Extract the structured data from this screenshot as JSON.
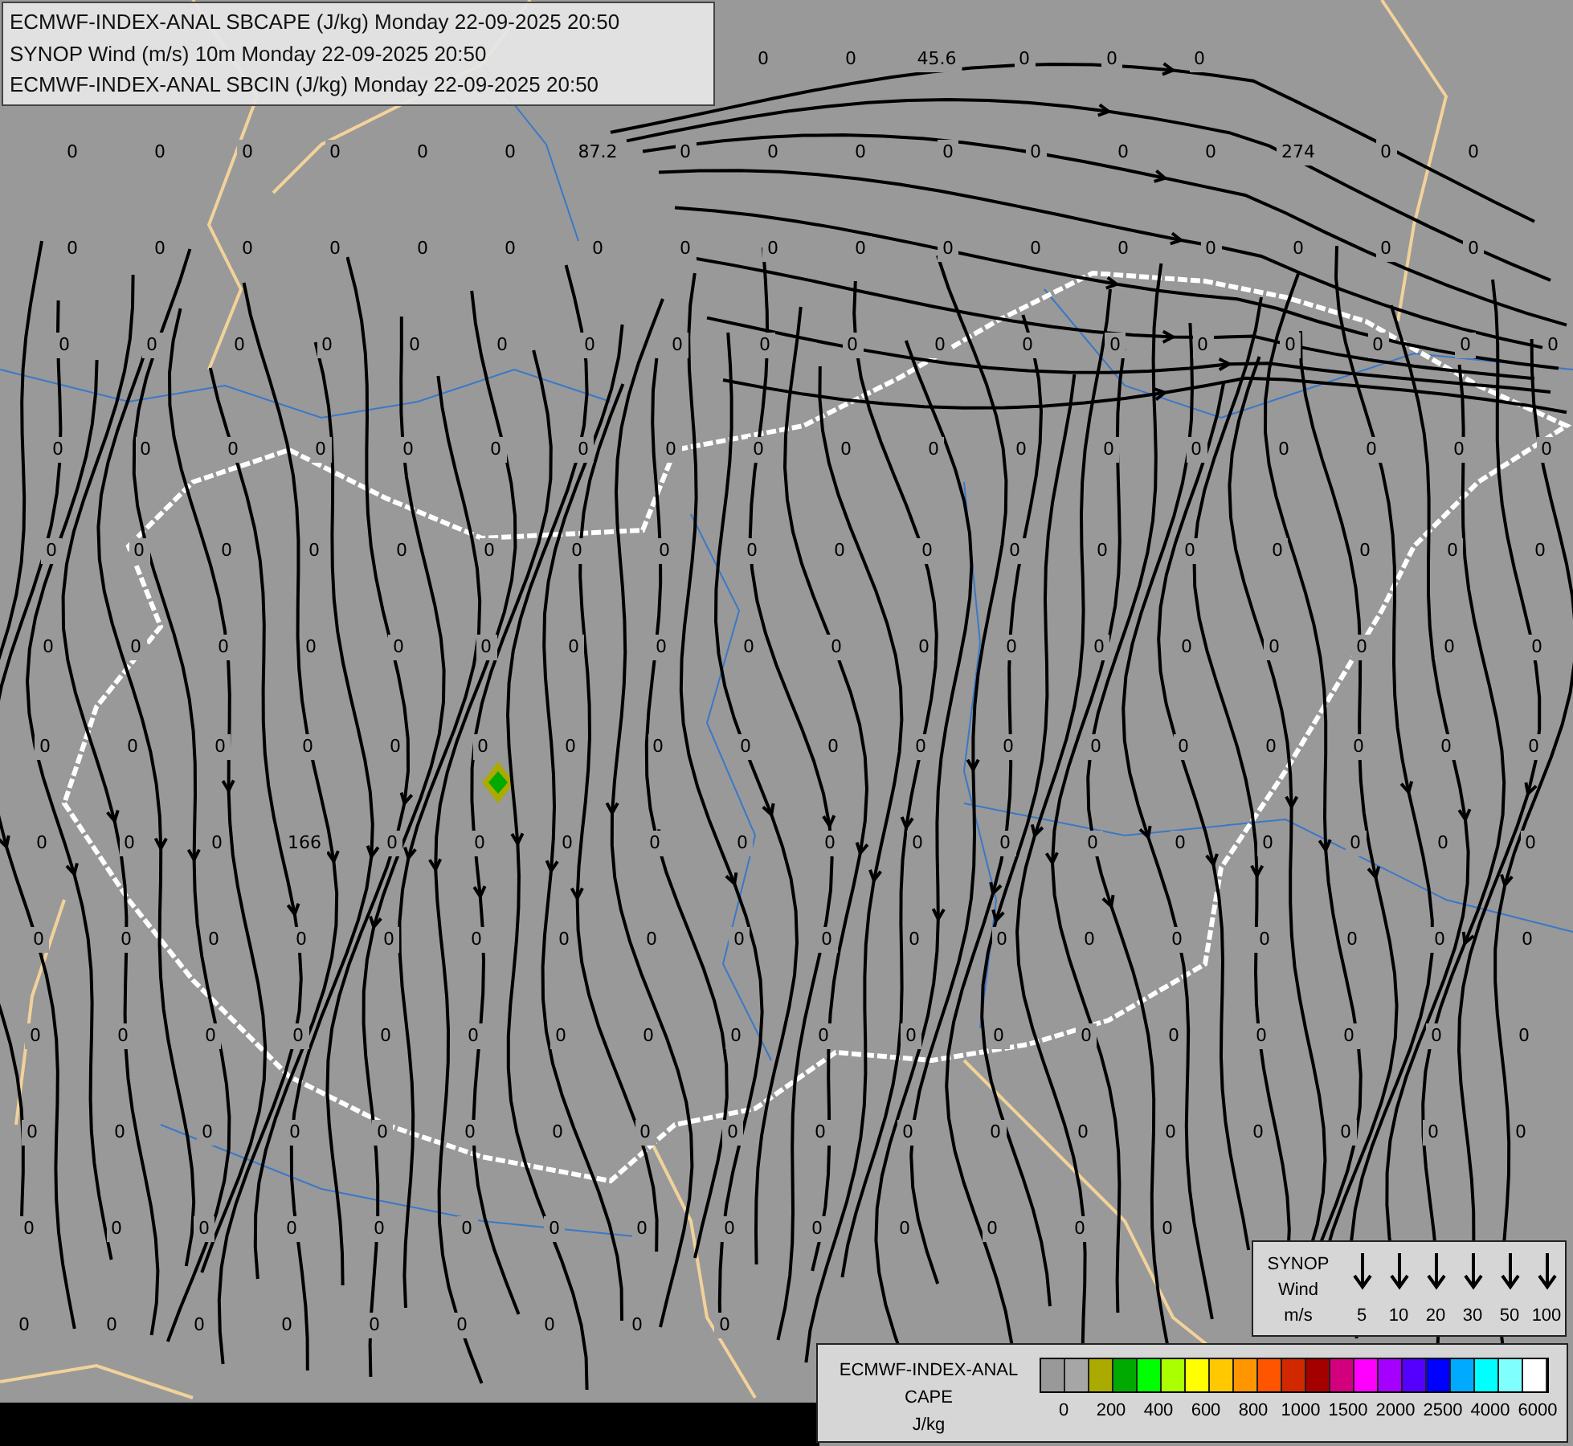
{
  "title_box": {
    "lines": [
      "ECMWF-INDEX-ANAL SBCAPE (J/kg) Monday 22-09-2025 20:50",
      "SYNOP Wind (m/s) 10m Monday 22-09-2025 20:50",
      "ECMWF-INDEX-ANAL SBCIN (J/kg) Monday 22-09-2025 20:50"
    ]
  },
  "map_values": [
    {
      "values": [
        "0",
        "0",
        "45.6",
        "0",
        "0",
        "0"
      ]
    },
    {
      "values": [
        "0",
        "0",
        "0",
        "0",
        "0",
        "0",
        "87.2",
        "0",
        "0",
        "0",
        "0",
        "0",
        "0",
        "0",
        "274",
        "0",
        "0"
      ]
    },
    {
      "values": [
        "0",
        "0",
        "0",
        "0",
        "0",
        "0",
        "0",
        "0",
        "0",
        "0",
        "0",
        "0",
        "0",
        "0",
        "0",
        "0",
        "0"
      ]
    },
    {
      "values": [
        "0",
        "0",
        "0",
        "0",
        "0",
        "0",
        "0",
        "0",
        "0",
        "0",
        "0",
        "0",
        "0",
        "0",
        "0",
        "0",
        "0",
        "0"
      ]
    },
    {
      "values": [
        "0",
        "0",
        "0",
        "0",
        "0",
        "0",
        "0",
        "0",
        "0",
        "0",
        "0",
        "0",
        "0",
        "0",
        "0",
        "0",
        "0",
        "0"
      ]
    },
    {
      "values": [
        "0",
        "0",
        "0",
        "0",
        "0",
        "0",
        "0",
        "0",
        "0",
        "0",
        "0",
        "0",
        "0",
        "0",
        "0",
        "0",
        "0",
        "0"
      ]
    },
    {
      "values": [
        "0",
        "0",
        "0",
        "0",
        "0",
        "0",
        "0",
        "0",
        "0",
        "0",
        "0",
        "0",
        "0",
        "0",
        "0",
        "0",
        "0",
        "0"
      ]
    },
    {
      "values": [
        "0",
        "0",
        "0",
        "0",
        "0",
        "0",
        "0",
        "0",
        "0",
        "0",
        "0",
        "0",
        "0",
        "0",
        "0",
        "0",
        "0",
        "0"
      ]
    },
    {
      "values": [
        "0",
        "0",
        "0",
        "166",
        "0",
        "0",
        "0",
        "0",
        "0",
        "0",
        "0",
        "0",
        "0",
        "0",
        "0",
        "0",
        "0",
        "0"
      ]
    },
    {
      "values": [
        "0",
        "0",
        "0",
        "0",
        "0",
        "0",
        "0",
        "0",
        "0",
        "0",
        "0",
        "0",
        "0",
        "0",
        "0",
        "0",
        "0",
        "0"
      ]
    },
    {
      "values": [
        "0",
        "0",
        "0",
        "0",
        "0",
        "0",
        "0",
        "0",
        "0",
        "0",
        "0",
        "0",
        "0",
        "0",
        "0",
        "0",
        "0",
        "0"
      ]
    },
    {
      "values": [
        "0",
        "0",
        "0",
        "0",
        "0",
        "0",
        "0",
        "0",
        "0",
        "0",
        "0",
        "0",
        "0",
        "0",
        "0",
        "0",
        "0",
        "0"
      ]
    },
    {
      "values": [
        "0",
        "0",
        "0",
        "0",
        "0",
        "0",
        "0",
        "0",
        "0",
        "0",
        "0",
        "0",
        "0",
        "0"
      ]
    },
    {
      "values": [
        "0",
        "0",
        "0",
        "0",
        "0",
        "0",
        "0",
        "0",
        "0"
      ]
    }
  ],
  "wind_legend": {
    "lines": [
      "SYNOP",
      "Wind",
      "m/s"
    ],
    "speeds": [
      "5",
      "10",
      "20",
      "30",
      "50",
      "100"
    ]
  },
  "cape_legend": {
    "lines": [
      "ECMWF-INDEX-ANAL",
      "CAPE",
      "J/kg"
    ],
    "swatches": [
      {
        "color": "#999999"
      },
      {
        "color": "#a6a6a6"
      },
      {
        "color": "#aaaa00"
      },
      {
        "color": "#00aa00"
      },
      {
        "color": "#00ff00"
      },
      {
        "color": "#aaff00"
      },
      {
        "color": "#ffff00"
      },
      {
        "color": "#ffc800"
      },
      {
        "color": "#ff9600"
      },
      {
        "color": "#ff5500"
      },
      {
        "color": "#d22800"
      },
      {
        "color": "#a50000"
      },
      {
        "color": "#d2007d"
      },
      {
        "color": "#ff00ff"
      },
      {
        "color": "#a500ff"
      },
      {
        "color": "#5500ff"
      },
      {
        "color": "#0000ff"
      },
      {
        "color": "#00aaff"
      },
      {
        "color": "#00ffff"
      },
      {
        "color": "#80ffff"
      },
      {
        "color": "#ffffff"
      }
    ],
    "labels": [
      "0",
      "200",
      "400",
      "600",
      "800",
      "1000",
      "1500",
      "2000",
      "2500",
      "4000",
      "6000"
    ]
  }
}
